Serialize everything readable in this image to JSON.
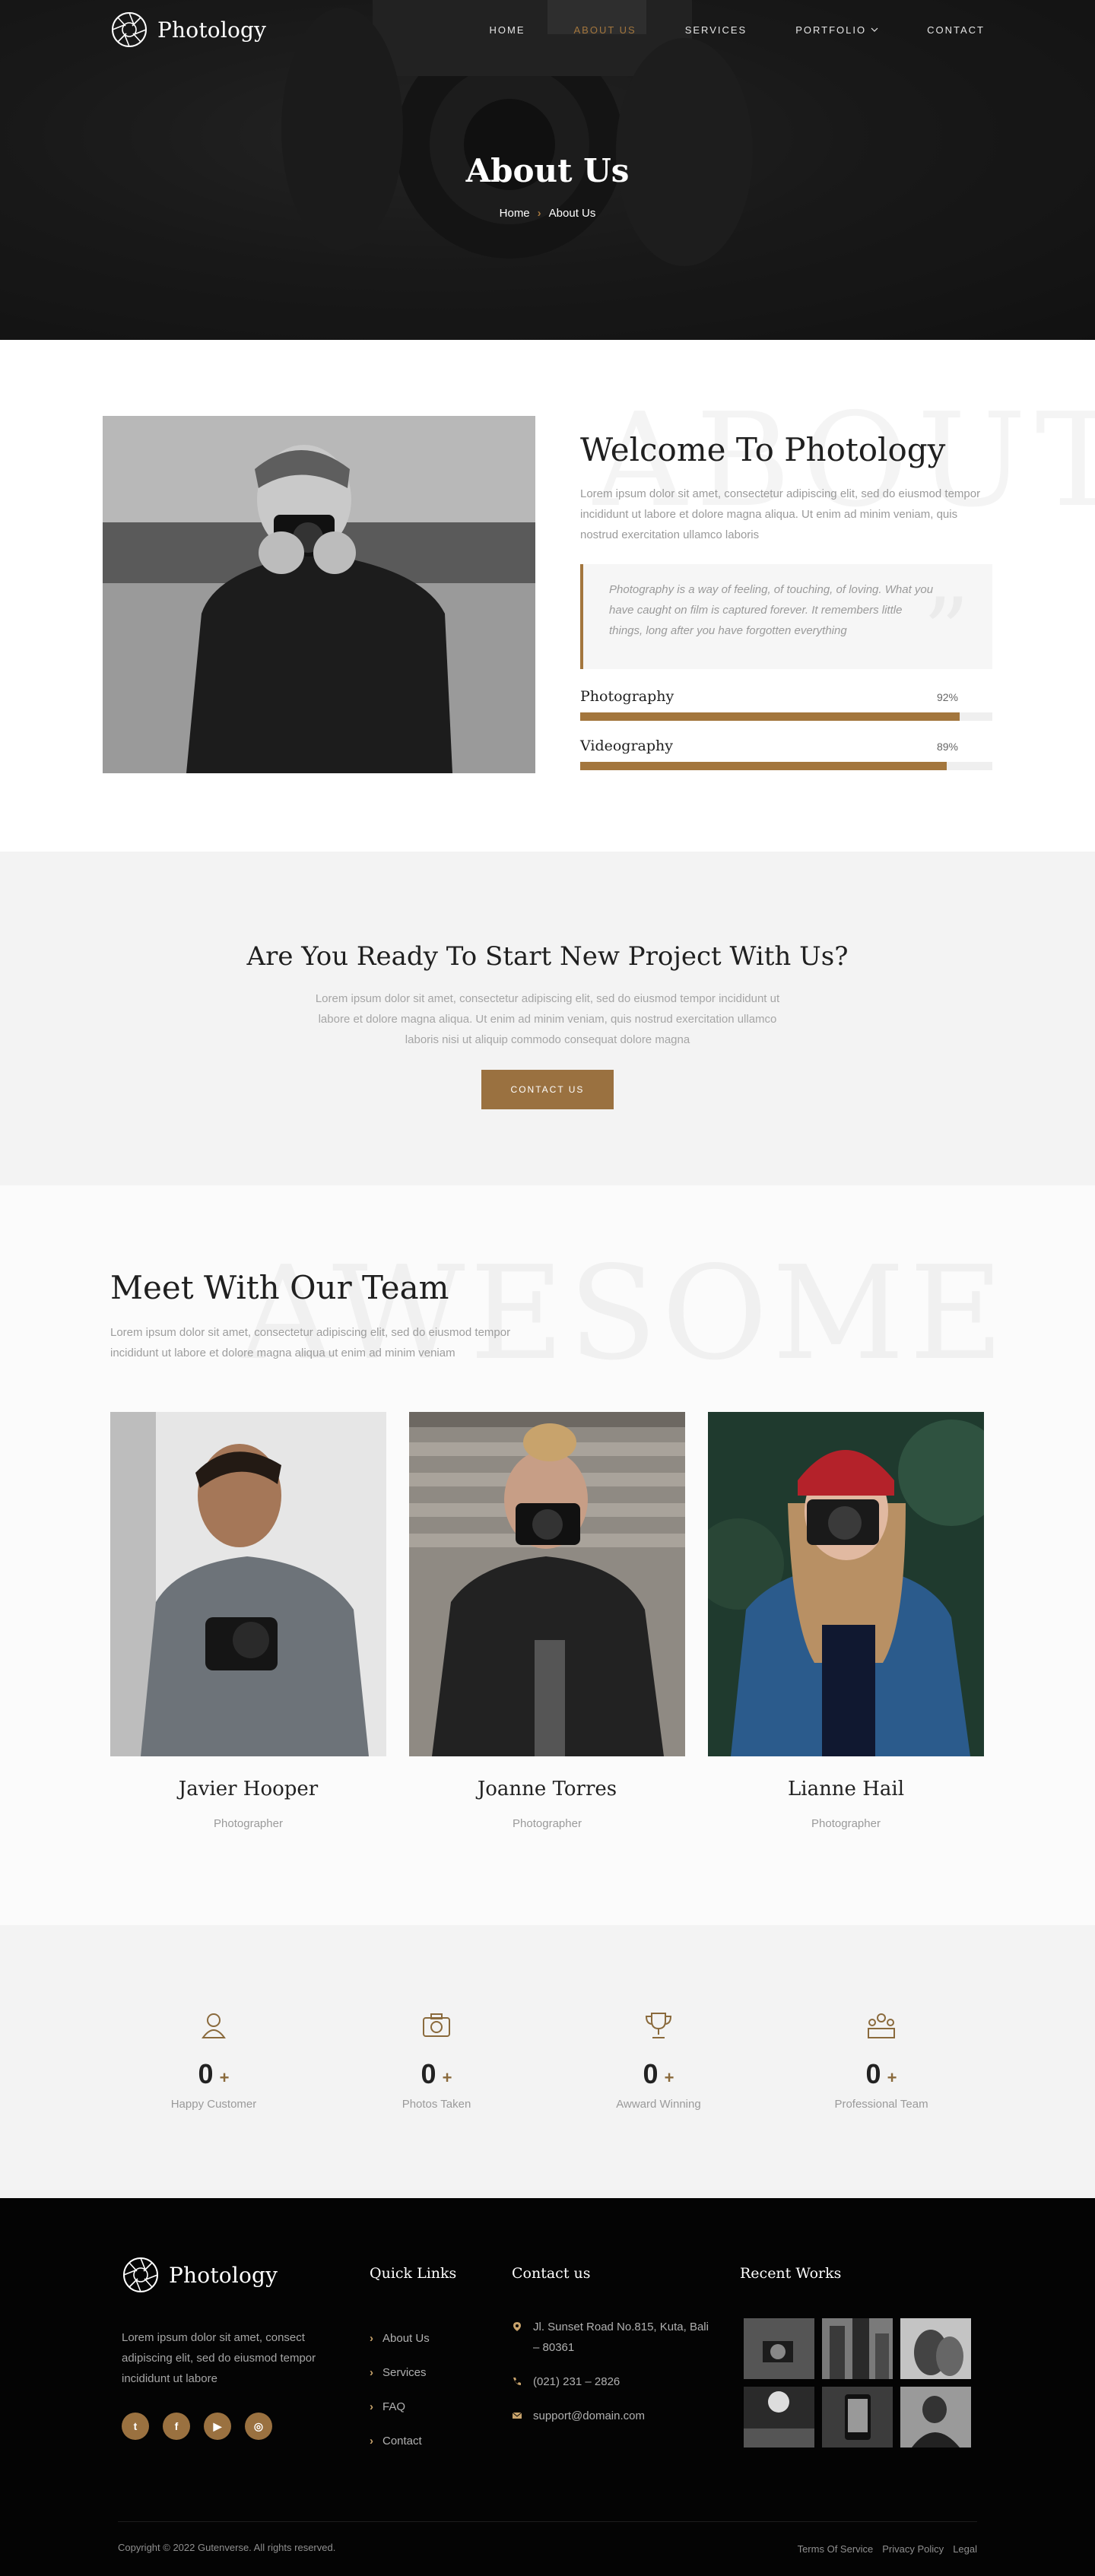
{
  "brand": {
    "name": "Photology",
    "accent": "#a3763d"
  },
  "nav": {
    "items": [
      {
        "label": "HOME"
      },
      {
        "label": "ABOUT US",
        "active": true
      },
      {
        "label": "SERVICES"
      },
      {
        "label": "PORTFOLIO",
        "has_dropdown": true
      },
      {
        "label": "CONTACT"
      }
    ]
  },
  "hero": {
    "title": "About Us",
    "breadcrumb_home": "Home",
    "breadcrumb_current": "About Us"
  },
  "about": {
    "bg_word": "ABOUT",
    "title": "Welcome To Photology",
    "lead": "Lorem ipsum dolor sit amet, consectetur adipiscing elit, sed do eiusmod tempor incididunt ut labore et dolore magna aliqua. Ut enim ad minim veniam, quis nostrud exercitation ullamco laboris",
    "quote": "Photography is a way of feeling, of touching, of loving. What you have caught on film is captured forever. It remembers little things, long after you have forgotten everything",
    "skills": [
      {
        "name": "Photography",
        "percent_label": "92%",
        "value": 0.92
      },
      {
        "name": "Videography",
        "percent_label": "89%",
        "value": 0.89
      }
    ]
  },
  "cta": {
    "title": "Are You Ready To Start New Project With Us?",
    "text": "Lorem ipsum dolor sit amet, consectetur adipiscing elit, sed do eiusmod tempor incididunt ut labore et dolore magna aliqua. Ut enim ad minim veniam, quis nostrud exercitation ullamco laboris nisi ut aliquip commodo consequat dolore magna",
    "button": "CONTACT US"
  },
  "team": {
    "bg_word": "AWESOME",
    "title": "Meet With Our Team",
    "lead": "Lorem ipsum dolor sit amet, consectetur adipiscing elit, sed do eiusmod tempor incididunt ut labore et dolore magna aliqua ut enim ad minim veniam",
    "members": [
      {
        "name": "Javier Hooper",
        "role": "Photographer"
      },
      {
        "name": "Joanne Torres",
        "role": "Photographer"
      },
      {
        "name": "Lianne Hail",
        "role": "Photographer"
      }
    ]
  },
  "stats": [
    {
      "icon": "customer-icon",
      "value": "0",
      "suffix": "+",
      "label": "Happy Customer"
    },
    {
      "icon": "camera-icon",
      "value": "0",
      "suffix": "+",
      "label": "Photos Taken"
    },
    {
      "icon": "trophy-icon",
      "value": "0",
      "suffix": "+",
      "label": "Awward Winning"
    },
    {
      "icon": "team-icon",
      "value": "0",
      "suffix": "+",
      "label": "Professional Team"
    }
  ],
  "footer": {
    "about": "Lorem ipsum dolor sit amet, consect adipiscing elit, sed do eiusmod tempor incididunt ut labore",
    "quick_links_title": "Quick Links",
    "quick_links": [
      "About Us",
      "Services",
      "FAQ",
      "Contact"
    ],
    "contact_title": "Contact us",
    "address": "Jl. Sunset Road No.815, Kuta, Bali – 80361",
    "phone": "(021) 231 – 2826",
    "email": "support@domain.com",
    "recent_title": "Recent Works",
    "copyright": "Copyright © 2022 Gutenverse. All rights reserved.",
    "legal": [
      "Terms Of Service",
      "Privacy Policy",
      "Legal"
    ]
  }
}
